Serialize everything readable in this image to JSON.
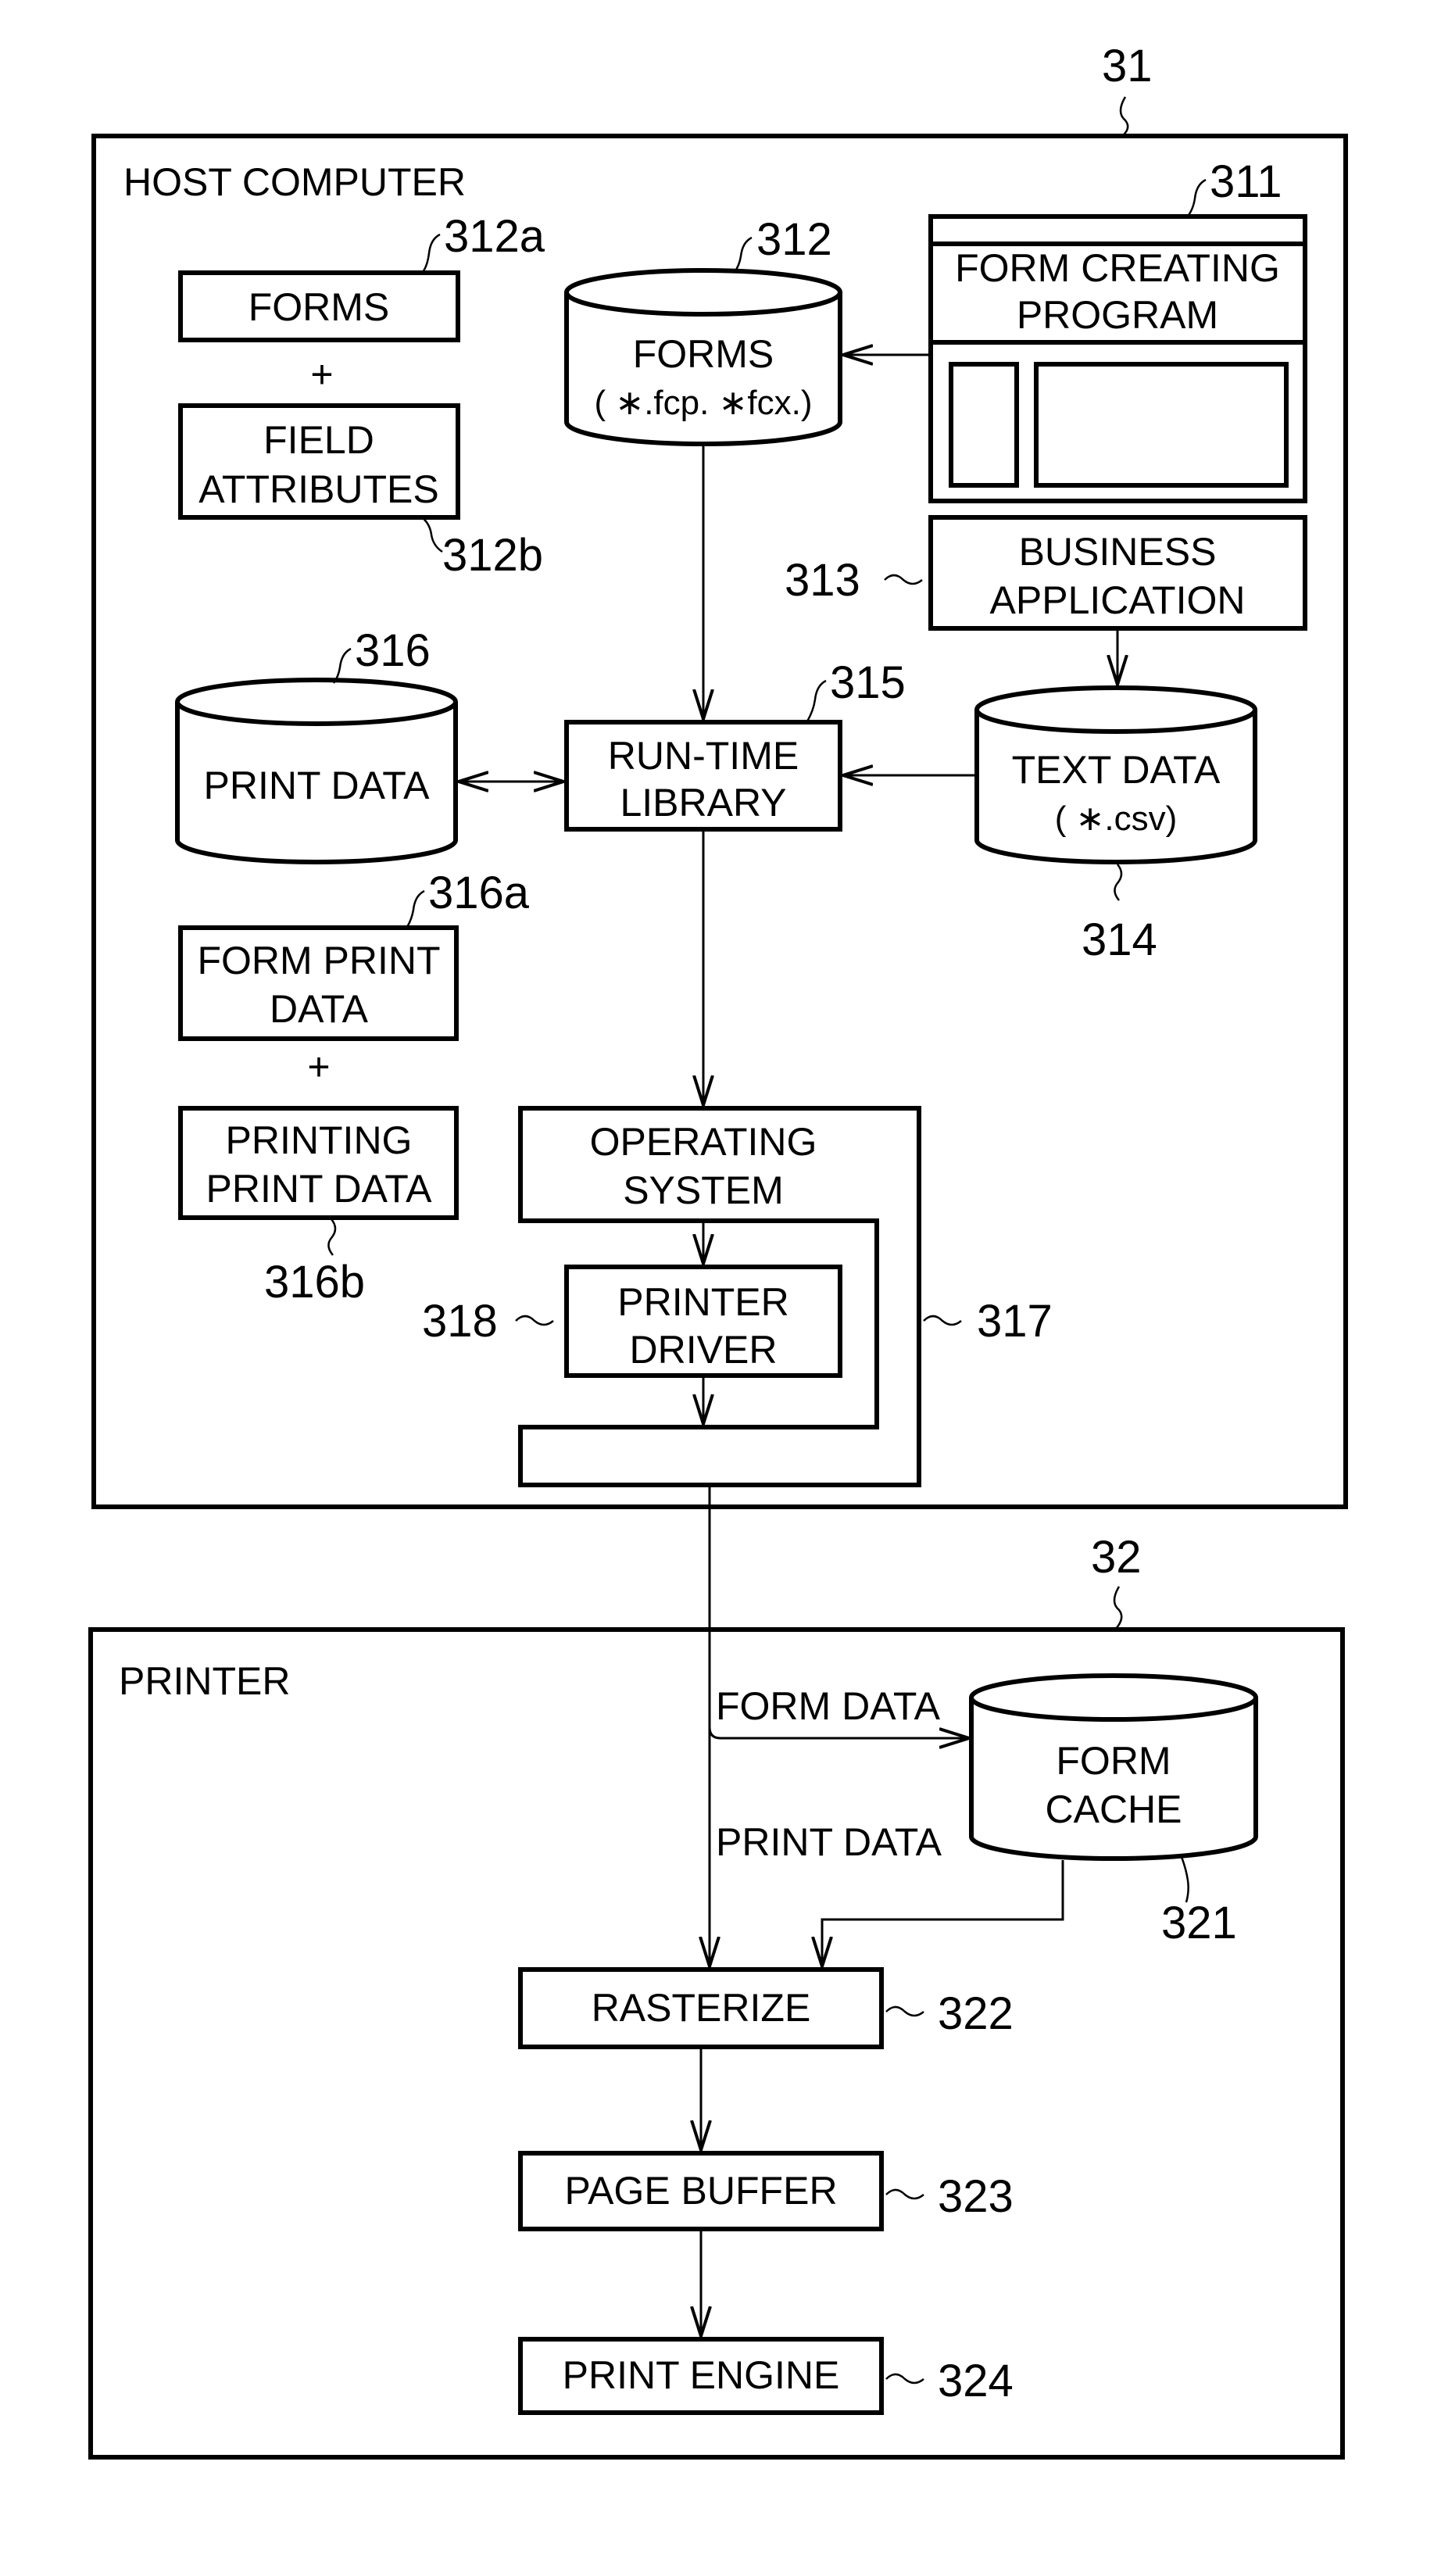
{
  "figure": {
    "host": {
      "ref": "31",
      "title": "HOST COMPUTER"
    },
    "printer": {
      "ref": "32",
      "title": "PRINTER"
    },
    "nodes": {
      "forms_box": {
        "ref": "312a",
        "lines": [
          "FORMS"
        ]
      },
      "plus1": "+",
      "field_attributes": {
        "ref": "312b",
        "lines": [
          "FIELD",
          "ATTRIBUTES"
        ]
      },
      "forms_db": {
        "ref": "312",
        "lines": [
          "FORMS",
          "( ∗.fcp. ∗fcx.)"
        ]
      },
      "form_creating_program": {
        "ref": "311",
        "lines": [
          "FORM CREATING",
          "PROGRAM"
        ]
      },
      "business_application": {
        "ref": "313",
        "lines": [
          "BUSINESS",
          "APPLICATION"
        ]
      },
      "print_data_db": {
        "ref": "316",
        "lines": [
          "PRINT  DATA"
        ]
      },
      "runtime_library": {
        "ref": "315",
        "lines": [
          "RUN-TIME",
          "LIBRARY"
        ]
      },
      "text_data_db": {
        "ref": "314",
        "lines": [
          "TEXT DATA",
          "( ∗.csv)"
        ]
      },
      "form_print_data": {
        "ref": "316a",
        "lines": [
          "FORM PRINT",
          "DATA"
        ]
      },
      "plus2": "+",
      "printing_print_data": {
        "ref": "316b",
        "lines": [
          "PRINTING",
          "PRINT DATA"
        ]
      },
      "operating_system": {
        "ref": "317",
        "lines": [
          "OPERATING",
          "SYSTEM"
        ]
      },
      "printer_driver": {
        "ref": "318",
        "lines": [
          "PRINTER",
          "DRIVER"
        ]
      },
      "form_cache": {
        "ref": "321",
        "lines": [
          "FORM",
          "CACHE"
        ]
      },
      "rasterize": {
        "ref": "322",
        "lines": [
          "RASTERIZE"
        ]
      },
      "page_buffer": {
        "ref": "323",
        "lines": [
          "PAGE BUFFER"
        ]
      },
      "print_engine": {
        "ref": "324",
        "lines": [
          "PRINT ENGINE"
        ]
      }
    },
    "edge_labels": {
      "form_data": "FORM  DATA",
      "print_data": "PRINT  DATA"
    }
  }
}
